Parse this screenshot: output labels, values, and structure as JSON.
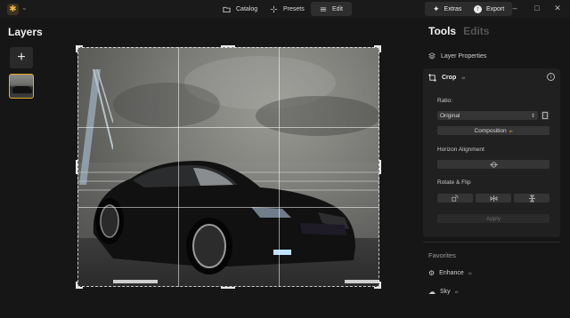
{
  "topbar": {
    "logo_glyph": "✱",
    "nav": [
      {
        "label": "Catalog",
        "icon": "folder-icon"
      },
      {
        "label": "Presets",
        "icon": "sparkle-icon"
      },
      {
        "label": "Edit",
        "icon": "sliders-icon",
        "active": true
      }
    ],
    "extras_label": "Extras",
    "export_label": "Export",
    "window_controls": [
      "–",
      "□",
      "✕"
    ]
  },
  "layers": {
    "title": "Layers",
    "add_label": "+"
  },
  "right_panel": {
    "tabs": [
      {
        "label": "Tools",
        "active": true
      },
      {
        "label": "Edits",
        "active": false
      }
    ],
    "layer_properties_label": "Layer Properties",
    "crop": {
      "title": "Crop",
      "badge": "AI",
      "info_glyph": "i",
      "ratio_label": "Ratio:",
      "ratio_value": "Original",
      "composition_label": "Composition",
      "composition_badge": "AI",
      "horizon_label": "Horizon Alignment",
      "rotate_label": "Rotate & Flip",
      "apply_label": "Apply"
    },
    "favorites": {
      "title": "Favorites",
      "items": [
        {
          "label": "Enhance",
          "badge": "AI"
        },
        {
          "label": "Sky",
          "badge": "AI"
        }
      ]
    }
  },
  "colors": {
    "accent": "#e9a927",
    "background": "#161616",
    "panel": "#202020"
  }
}
